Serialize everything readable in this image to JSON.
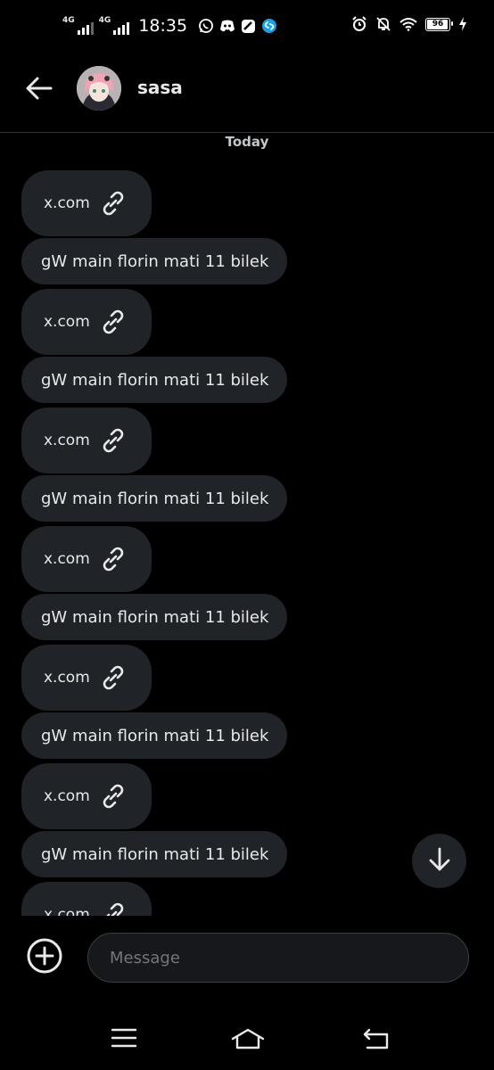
{
  "status_bar": {
    "net1_label": "4G",
    "net2_label": "4G",
    "time": "18:35",
    "battery": "96",
    "icons": [
      "whatsapp-icon",
      "discord-icon",
      "app-icon",
      "shazam-icon",
      "alarm-icon",
      "mute-icon",
      "wifi-icon",
      "charging-icon"
    ]
  },
  "header": {
    "title": "sasa",
    "back_icon": "arrow-left-icon"
  },
  "day_separator": "Today",
  "messages": [
    {
      "type": "link",
      "text": "x.com"
    },
    {
      "type": "text",
      "text": "gW main florin mati 11 bilek"
    },
    {
      "type": "link",
      "text": "x.com"
    },
    {
      "type": "text",
      "text": "gW main florin mati 11 bilek"
    },
    {
      "type": "link",
      "text": "x.com"
    },
    {
      "type": "text",
      "text": "gW main florin mati 11 bilek"
    },
    {
      "type": "link",
      "text": "x.com"
    },
    {
      "type": "text",
      "text": "gW main florin mati 11 bilek"
    },
    {
      "type": "link",
      "text": "x.com"
    },
    {
      "type": "text",
      "text": "gW main florin mati 11 bilek"
    },
    {
      "type": "link",
      "text": "x.com"
    },
    {
      "type": "text",
      "text": "gW main florin mati 11 bilek"
    },
    {
      "type": "link",
      "text": "x.com"
    }
  ],
  "composer": {
    "placeholder": "Message",
    "value": ""
  },
  "colors": {
    "background": "#000000",
    "bubble": "#202327",
    "text": "#e7e9ea",
    "muted": "#71767b"
  }
}
